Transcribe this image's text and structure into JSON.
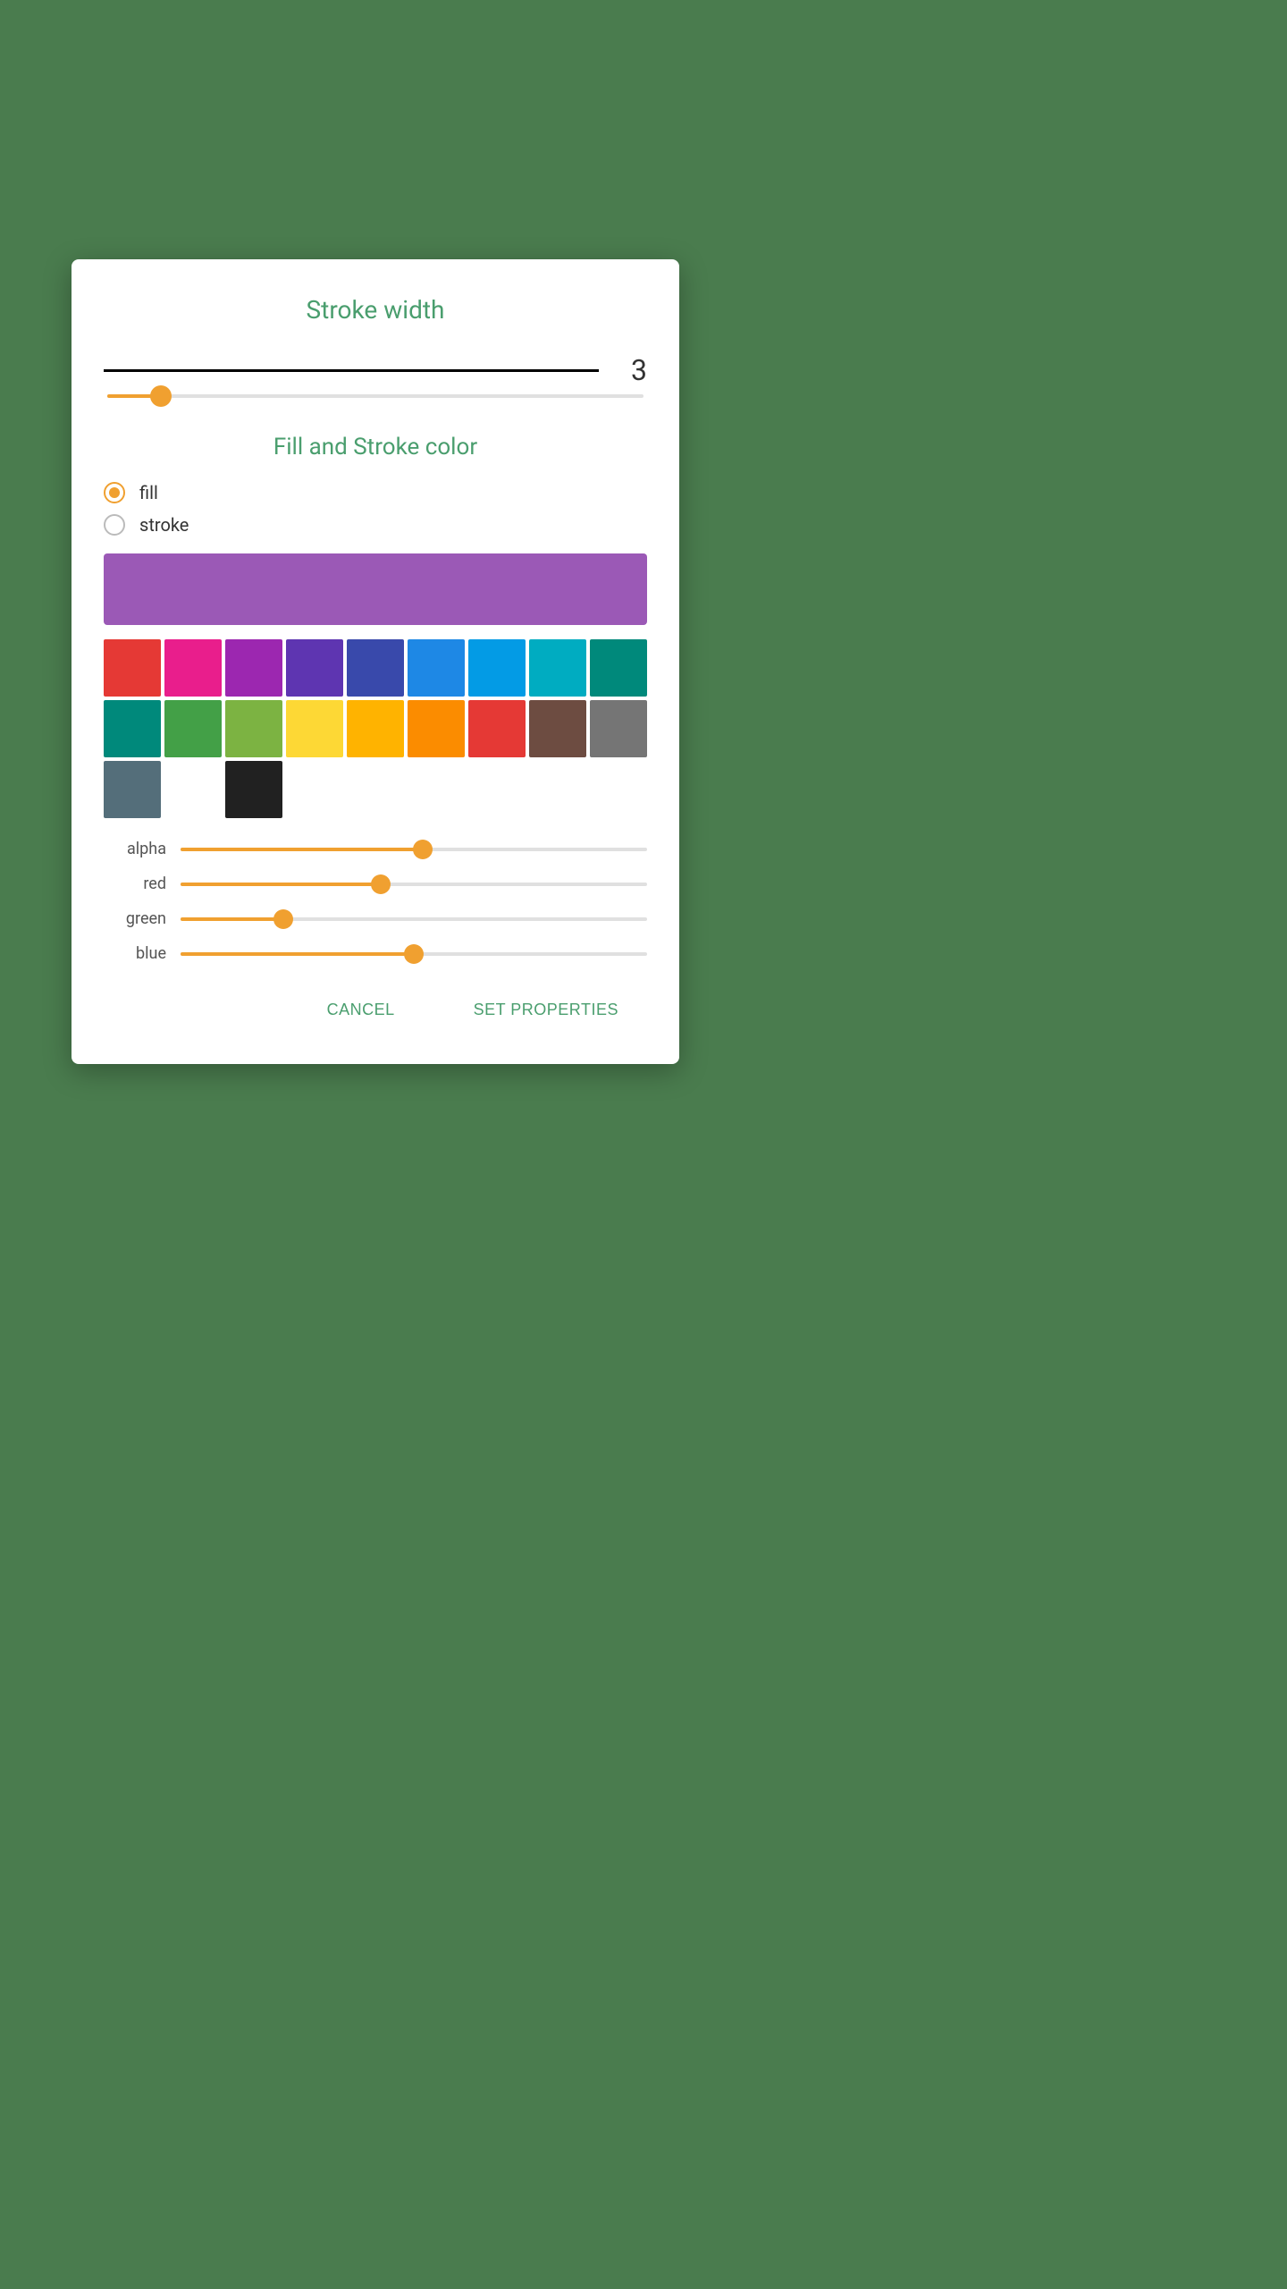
{
  "dialog": {
    "title": "Stroke width",
    "stroke_value": "3",
    "stroke_line_width": "3px"
  },
  "fill_stroke": {
    "section_title": "Fill and Stroke color",
    "fill_label": "fill",
    "stroke_label": "stroke",
    "fill_selected": true,
    "color_preview": "#9b59b6"
  },
  "color_grid": {
    "colors": [
      "#e53935",
      "#e91e8c",
      "#9c27b0",
      "#5e35b1",
      "#3949ab",
      "#1e88e5",
      "#039be5",
      "#00acc1",
      "#00897b",
      "#00897b",
      "#43a047",
      "#7cb342",
      "#fdd835",
      "#ffb300",
      "#fb8c00",
      "#e53935",
      "#6d4c41",
      "#757575",
      "#546e7a",
      "",
      "#212121",
      "",
      "",
      "",
      "",
      "",
      ""
    ]
  },
  "sliders": {
    "alpha": {
      "label": "alpha",
      "value": 0.52,
      "percent": "52%"
    },
    "red": {
      "label": "red",
      "value": 0.43,
      "percent": "43%"
    },
    "green": {
      "label": "green",
      "value": 0.22,
      "percent": "22%"
    },
    "blue": {
      "label": "blue",
      "value": 0.5,
      "percent": "50%"
    }
  },
  "buttons": {
    "cancel": "CANCEL",
    "set_properties": "SET PROPERTIES"
  },
  "stroke_slider": {
    "percent": "10%"
  }
}
